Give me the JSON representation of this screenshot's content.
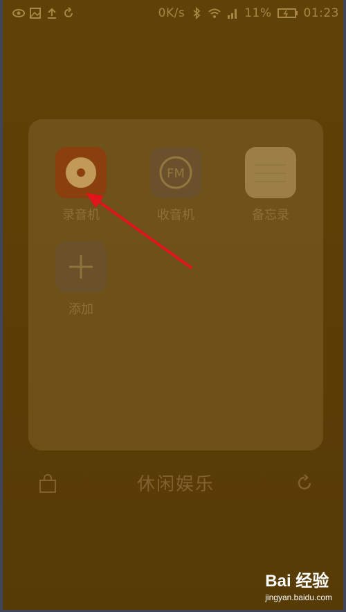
{
  "status_bar": {
    "speed": "0K/s",
    "battery": "11%",
    "time": "01:23"
  },
  "folder": {
    "title": "休闲娱乐",
    "apps": [
      {
        "label": "录音机",
        "icon": "recorder-icon"
      },
      {
        "label": "收音机",
        "icon": "radio-icon"
      },
      {
        "label": "备忘录",
        "icon": "memo-icon"
      },
      {
        "label": "添加",
        "icon": "add-icon"
      }
    ],
    "radio_icon_text": "FM"
  },
  "colors": {
    "background": "#5c3f06",
    "recorder_accent": "#8a3f0c",
    "annotation_arrow": "#e0141b"
  },
  "watermark": {
    "logo": "Bai 经验",
    "url": "jingyan.baidu.com"
  }
}
